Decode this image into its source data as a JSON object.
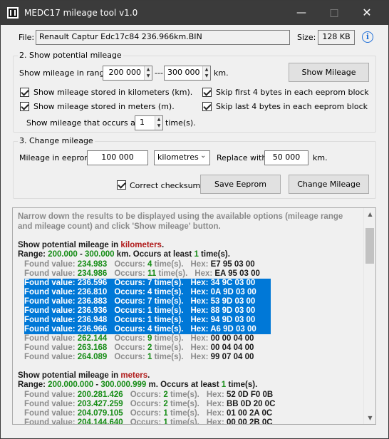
{
  "window": {
    "title": "MEDC17 mileage tool  v1.0"
  },
  "titlebar_buttons": {
    "minimize": "—",
    "maximize": "□",
    "close": "✕"
  },
  "file": {
    "label": "File:",
    "value": "Renault Captur Edc17c84  236.966km.BIN",
    "size_label": "Size:",
    "size_value": "128 KB"
  },
  "show_group": {
    "title": "2. Show potential mileage",
    "range_label": "Show mileage in range:",
    "range_from": "200 000",
    "range_sep": "---",
    "range_to": "300 000",
    "range_unit": "km.",
    "show_button": "Show Mileage",
    "cb_km": "Show mileage stored in kilometers (km).",
    "cb_m": "Show mileage stored in meters (m).",
    "cb_skip_first": "Skip first 4 bytes in each eeprom block",
    "cb_skip_last": "Skip last 4 bytes in each eeprom block",
    "occurs_label": "Show mileage that occurs at least",
    "occurs_value": "1",
    "occurs_suffix": "time(s)."
  },
  "change_group": {
    "title": "3. Change mileage",
    "eeprom_label": "Mileage in eeprom:",
    "eeprom_value": "100 000",
    "unit_selected": "kilometres",
    "replace_label": "Replace with",
    "replace_value": "50 000",
    "replace_unit": "km.",
    "checksum_label": "Correct checksums",
    "save_button": "Save Eeprom",
    "change_button": "Change Mileage"
  },
  "output": {
    "hint1": "Narrow down the results to be displayed using the available options (mileage range",
    "hint2": "and mileage count) and click 'Show mileage' button.",
    "km_section": {
      "heading_prefix": "Show potential mileage in ",
      "heading_unit": "kilometers",
      "heading_suffix": ".",
      "range_prefix": "Range: ",
      "range_from": "200.000",
      "range_dash": " - ",
      "range_to": "300.000",
      "range_unit_occ": " km. Occurs at least ",
      "range_count": "1",
      "range_suffix": " time(s).",
      "rows": [
        {
          "value": "234.983",
          "count": "4",
          "hex": "E7 95 03 00",
          "selected": false
        },
        {
          "value": "234.986",
          "count": "11",
          "hex": "EA 95 03 00",
          "selected": false
        },
        {
          "value": "236.596",
          "count": "7",
          "hex": "34 9C 03 00",
          "selected": true
        },
        {
          "value": "236.810",
          "count": "4",
          "hex": "0A 9D 03 00",
          "selected": true
        },
        {
          "value": "236.883",
          "count": "7",
          "hex": "53 9D 03 00",
          "selected": true
        },
        {
          "value": "236.936",
          "count": "1",
          "hex": "88 9D 03 00",
          "selected": true
        },
        {
          "value": "236.948",
          "count": "1",
          "hex": "94 9D 03 00",
          "selected": true
        },
        {
          "value": "236.966",
          "count": "4",
          "hex": "A6 9D 03 00",
          "selected": true
        },
        {
          "value": "262.144",
          "count": "9",
          "hex": "00 00 04 00",
          "selected": false
        },
        {
          "value": "263.168",
          "count": "2",
          "hex": "00 04 04 00",
          "selected": false
        },
        {
          "value": "264.089",
          "count": "1",
          "hex": "99 07 04 00",
          "selected": false
        }
      ]
    },
    "m_section": {
      "heading_prefix": "Show potential mileage in ",
      "heading_unit": "meters",
      "heading_suffix": ".",
      "range_prefix": "Range: ",
      "range_from": "200.000.000",
      "range_dash": " - ",
      "range_to": "300.000.999",
      "range_unit_occ": " m. Occurs at least ",
      "range_count": "1",
      "range_suffix": " time(s).",
      "rows": [
        {
          "value": "200.281.426",
          "count": "2",
          "hex": "52 0D F0 0B"
        },
        {
          "value": "203.427.259",
          "count": "2",
          "hex": "BB 0D 20 0C"
        },
        {
          "value": "204.079.105",
          "count": "1",
          "hex": "01 00 2A 0C"
        },
        {
          "value": "204.144.640",
          "count": "1",
          "hex": "00 00 2B 0C"
        }
      ]
    },
    "row_labels": {
      "found": "Found value: ",
      "occurs": "Occurs: ",
      "times": " time(s).",
      "hex": "Hex: "
    }
  }
}
